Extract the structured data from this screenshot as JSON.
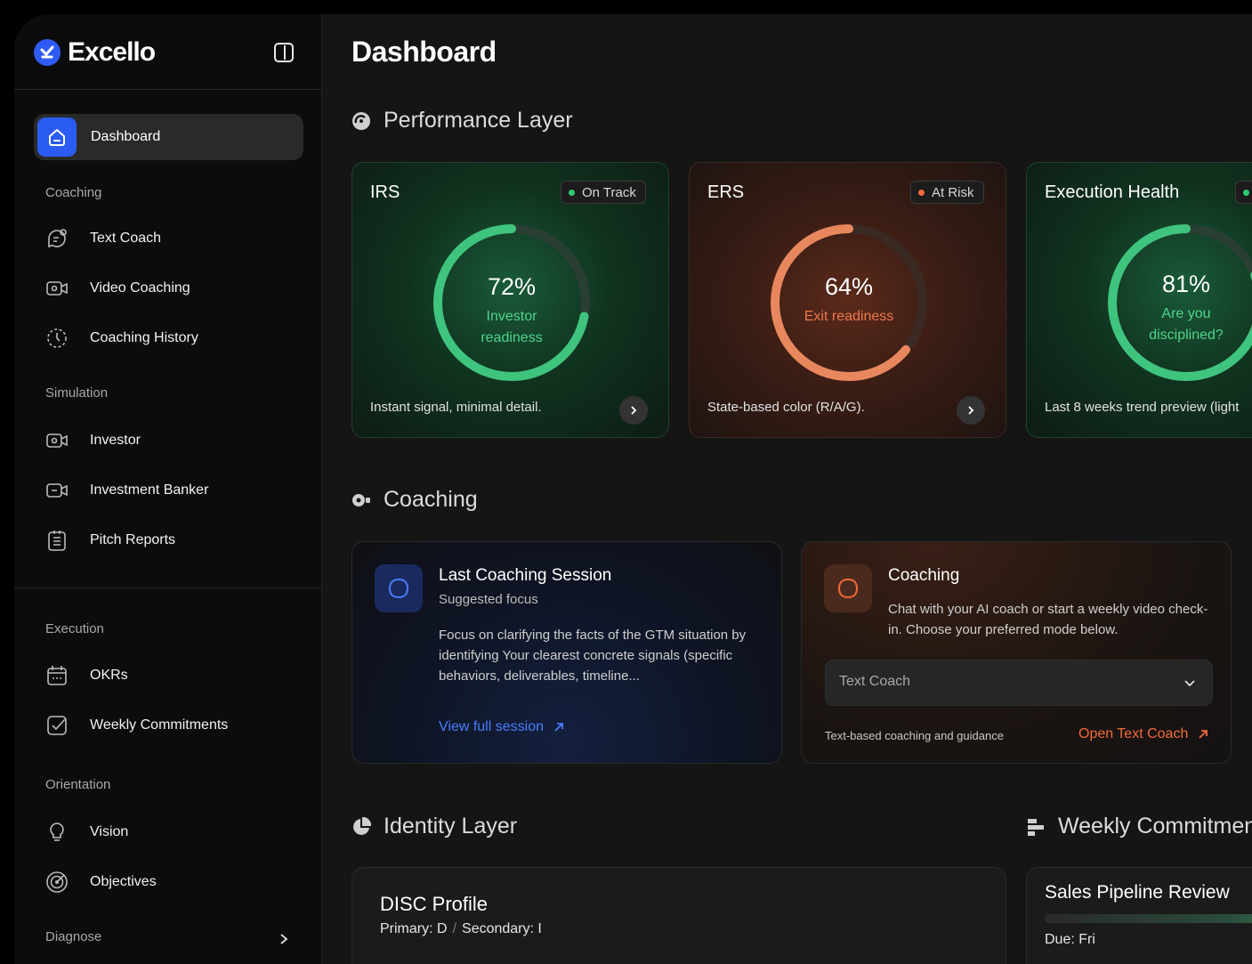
{
  "brand": {
    "name": "Excello"
  },
  "nav": {
    "active": {
      "label": "Dashboard",
      "icon": "home-icon"
    },
    "sections": [
      {
        "label": "Coaching",
        "items": [
          {
            "label": "Text Coach",
            "icon": "chat-icon"
          },
          {
            "label": "Video Coaching",
            "icon": "video-icon"
          },
          {
            "label": "Coaching History",
            "icon": "history-icon"
          }
        ]
      },
      {
        "label": "Simulation",
        "items": [
          {
            "label": "Investor",
            "icon": "video-icon"
          },
          {
            "label": "Investment Banker",
            "icon": "video-icon"
          },
          {
            "label": "Pitch Reports",
            "icon": "report-icon"
          }
        ]
      },
      {
        "label": "Execution",
        "items": [
          {
            "label": "OKRs",
            "icon": "calendar-icon"
          },
          {
            "label": "Weekly Commitments",
            "icon": "checkbox-icon"
          }
        ]
      },
      {
        "label": "Orientation",
        "items": [
          {
            "label": "Vision",
            "icon": "lightbulb-icon"
          },
          {
            "label": "Objectives",
            "icon": "target-icon"
          }
        ]
      },
      {
        "label": "Diagnose",
        "items": []
      }
    ]
  },
  "page": {
    "title": "Dashboard"
  },
  "performance": {
    "heading": "Performance Layer",
    "cards": [
      {
        "title": "IRS",
        "status": "On Track",
        "status_color": "#2ecc71",
        "value": "72%",
        "progress": 0.72,
        "sub_line1": "Investor",
        "sub_line2": "readiness",
        "footer": "Instant signal, minimal detail.",
        "tone": "green"
      },
      {
        "title": "ERS",
        "status": "At Risk",
        "status_color": "#f06a3c",
        "value": "64%",
        "progress": 0.64,
        "sub_line1": "Exit readiness",
        "sub_line2": "",
        "footer": "State-based color (R/A/G).",
        "tone": "red"
      },
      {
        "title": "Execution Health",
        "status": "",
        "status_color": "#2ecc71",
        "value": "81%",
        "progress": 0.81,
        "sub_line1": "Are you",
        "sub_line2": "disciplined?",
        "footer": "Last 8 weeks trend preview (light",
        "tone": "green"
      }
    ]
  },
  "coaching": {
    "heading": "Coaching",
    "last_session": {
      "title": "Last Coaching Session",
      "subtitle": "Suggested focus",
      "body": "Focus on clarifying the facts of the GTM situation by identifying Your clearest concrete signals (specific behaviors, deliverables, timeline...",
      "link": "View full session",
      "accent": "#4a7dff"
    },
    "coach": {
      "title": "Coaching",
      "body": "Chat with your AI coach or start a weekly video check-in. Choose your preferred mode below.",
      "select_value": "Text Coach",
      "note": "Text-based coaching and guidance",
      "link": "Open Text Coach",
      "accent": "#f26b3a"
    }
  },
  "identity": {
    "heading": "Identity Layer",
    "disc": {
      "title": "DISC Profile",
      "primary": "Primary: D",
      "separator": "/",
      "secondary": "Secondary: I"
    }
  },
  "weekly": {
    "heading": "Weekly Commitment",
    "card": {
      "title": "Sales Pipeline Review",
      "due": "Due: Fri"
    }
  }
}
